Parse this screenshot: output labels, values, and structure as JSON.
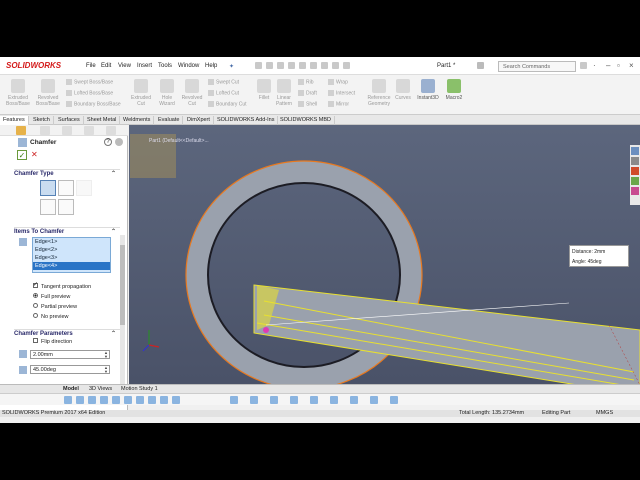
{
  "app": {
    "logo": "SOLIDWORKS",
    "doc_title": "Part1 *"
  },
  "menu": [
    "File",
    "Edit",
    "View",
    "Insert",
    "Tools",
    "Window",
    "Help"
  ],
  "search": {
    "placeholder": "Search Commands"
  },
  "commands": {
    "extruded_boss": "Extruded Boss/Base",
    "revolved_boss": "Revolved Boss/Base",
    "swept_boss": "Swept Boss/Base",
    "lofted_boss": "Lofted Boss/Base",
    "boundary_boss": "Boundary Boss/Base",
    "extruded_cut": "Extruded Cut",
    "hole_wizard": "Hole Wizard",
    "revolved_cut": "Revolved Cut",
    "swept_cut": "Swept Cut",
    "lofted_cut": "Lofted Cut",
    "boundary_cut": "Boundary Cut",
    "fillet": "Fillet",
    "linear_pattern": "Linear Pattern",
    "rib": "Rib",
    "draft": "Draft",
    "shell": "Shell",
    "wrap": "Wrap",
    "intersect": "Intersect",
    "mirror": "Mirror",
    "reference_geometry": "Reference Geometry",
    "curves": "Curves",
    "instant3d": "Instant3D",
    "macro": "Macro2"
  },
  "tabs": [
    "Features",
    "Sketch",
    "Surfaces",
    "Sheet Metal",
    "Weldments",
    "Evaluate",
    "DimXpert",
    "SOLIDWORKS Add-Ins",
    "SOLIDWORKS MBD"
  ],
  "tree_path": "Part1 (Default<<Default>...",
  "pm": {
    "title": "Chamfer",
    "chamfer_type_label": "Chamfer Type",
    "items_label": "Items To Chamfer",
    "edges": [
      "Edge<1>",
      "Edge<2>",
      "Edge<3>",
      "Edge<4>"
    ],
    "tangent_propagation": "Tangent propagation",
    "full_preview": "Full preview",
    "partial_preview": "Partial preview",
    "no_preview": "No preview",
    "params_label": "Chamfer Parameters",
    "flip_direction": "Flip direction",
    "distance_value": "2.00mm",
    "angle_value": "45.00deg"
  },
  "callout": {
    "distance_label": "Distance:",
    "distance_value": "2mm",
    "angle_label": "Angle:",
    "angle_value": "45deg"
  },
  "bottom_tabs": [
    "Model",
    "3D Views",
    "Motion Study 1"
  ],
  "status": {
    "edition": "SOLIDWORKS Premium 2017 x64 Edition",
    "length": "Total Length: 135.2734mm",
    "mode": "Editing Part",
    "units": "MMGS"
  }
}
